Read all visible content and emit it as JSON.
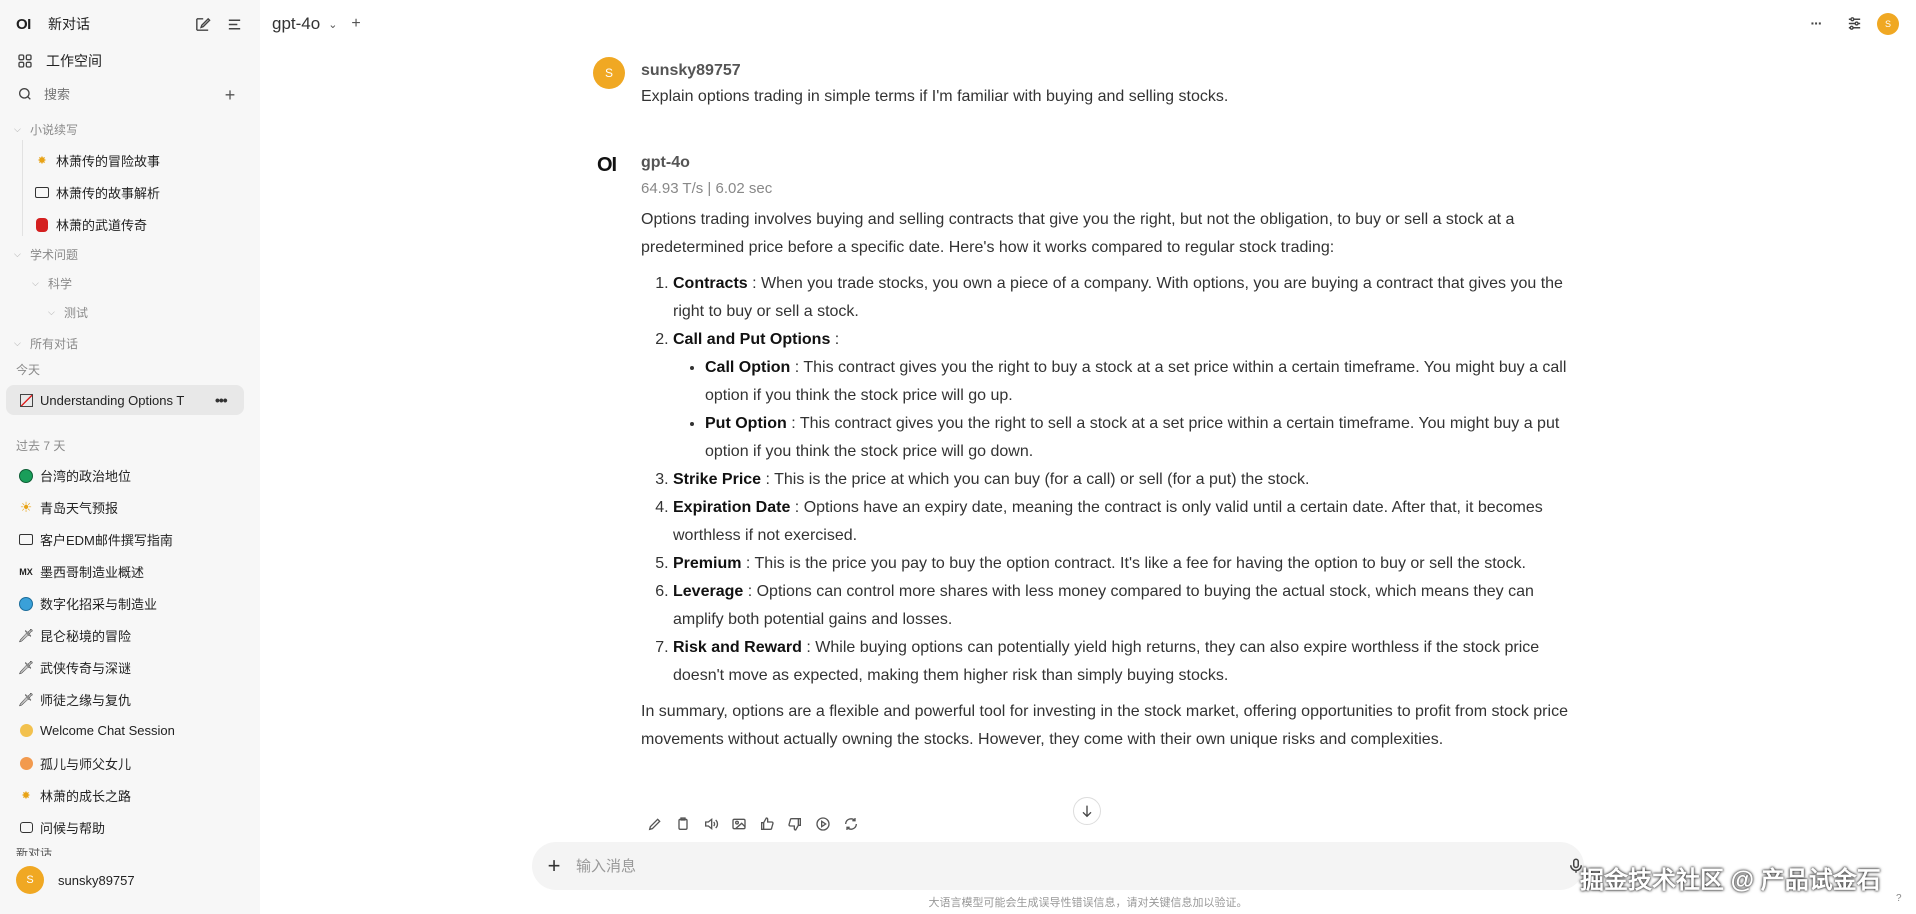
{
  "sidebar": {
    "logo": "OI",
    "new_chat": "新对话",
    "workspace": "工作空间",
    "search_placeholder": "搜索",
    "folders": {
      "f1": "小说续写",
      "f1_items": [
        "林萧传的冒险故事",
        "林萧传的故事解析",
        "林萧的武道传奇"
      ],
      "f2": "学术问题",
      "f2_sub": "科学",
      "f2_subsub": "测试",
      "f3": "所有对话"
    },
    "today_label": "今天",
    "active_chat": "Understanding Options T",
    "past7_label": "过去 7 天",
    "chats": [
      {
        "label": "台湾的政治地位",
        "icon": "globe-icon"
      },
      {
        "label": "青岛天气预报",
        "icon": "sun-icon"
      },
      {
        "label": "客户EDM邮件撰写指南",
        "icon": "email-icon"
      },
      {
        "label": "墨西哥制造业概述",
        "icon": "flag-mx-icon"
      },
      {
        "label": "数字化招采与制造业",
        "icon": "globe-icon"
      },
      {
        "label": "昆仑秘境的冒险",
        "icon": "sword-icon"
      },
      {
        "label": "武侠传奇与深谜",
        "icon": "sword-icon"
      },
      {
        "label": "师徒之缘与复仇",
        "icon": "sword-icon"
      },
      {
        "label": "Welcome Chat Session",
        "icon": "wave-icon"
      },
      {
        "label": "孤儿与师父女儿",
        "icon": "person-icon"
      },
      {
        "label": "林萧的成长之路",
        "icon": "sparkle-icon"
      },
      {
        "label": "问候与帮助",
        "icon": "chat-icon"
      }
    ],
    "mx_prefix": "MX",
    "cut_label": "新对话",
    "user": {
      "initial": "S",
      "name": "sunsky89757"
    }
  },
  "header": {
    "model": "gpt-4o",
    "avatar_initial": "S"
  },
  "chat": {
    "user_msg": {
      "initial": "S",
      "name": "sunsky89757",
      "text": "Explain options trading in simple terms if I'm familiar with buying and selling stocks."
    },
    "assistant": {
      "logo": "OI",
      "name": "gpt-4o",
      "meta": "64.93 T/s | 6.02 sec",
      "intro": "Options trading involves buying and selling contracts that give you the right, but not the obligation, to buy or sell a stock at a predetermined price before a specific date. Here's how it works compared to regular stock trading:",
      "items": [
        {
          "term": "Contracts",
          "text": " : When you trade stocks, you own a piece of a company. With options, you are buying a contract that gives you the right to buy or sell a stock."
        },
        {
          "term": "Call and Put Options",
          "text": " :"
        },
        {
          "term": "Strike Price",
          "text": " : This is the price at which you can buy (for a call) or sell (for a put) the stock."
        },
        {
          "term": "Expiration Date",
          "text": " : Options have an expiry date, meaning the contract is only valid until a certain date. After that, it becomes worthless if not exercised."
        },
        {
          "term": "Premium",
          "text": " : This is the price you pay to buy the option contract. It's like a fee for having the option to buy or sell the stock."
        },
        {
          "term": "Leverage",
          "text": " : Options can control more shares with less money compared to buying the actual stock, which means they can amplify both potential gains and losses."
        },
        {
          "term": "Risk and Reward",
          "text": " : While buying options can potentially yield high returns, they can also expire worthless if the stock price doesn't move as expected, making them higher risk than simply buying stocks."
        }
      ],
      "sub_items": [
        {
          "term": "Call Option",
          "text": " : This contract gives you the right to buy a stock at a set price within a certain timeframe. You might buy a call option if you think the stock price will go up."
        },
        {
          "term": "Put Option",
          "text": " : This contract gives you the right to sell a stock at a set price within a certain timeframe. You might buy a put option if you think the stock price will go down."
        }
      ],
      "summary": "In summary, options are a flexible and powerful tool for investing in the stock market, offering opportunities to profit from stock price movements without actually owning the stocks. However, they come with their own unique risks and complexities."
    }
  },
  "input": {
    "placeholder": "输入消息"
  },
  "disclaimer": "大语言模型可能会生成误导性错误信息，请对关键信息加以验证。",
  "watermark": "掘金技术社区 @ 产品试金石",
  "help": "?"
}
